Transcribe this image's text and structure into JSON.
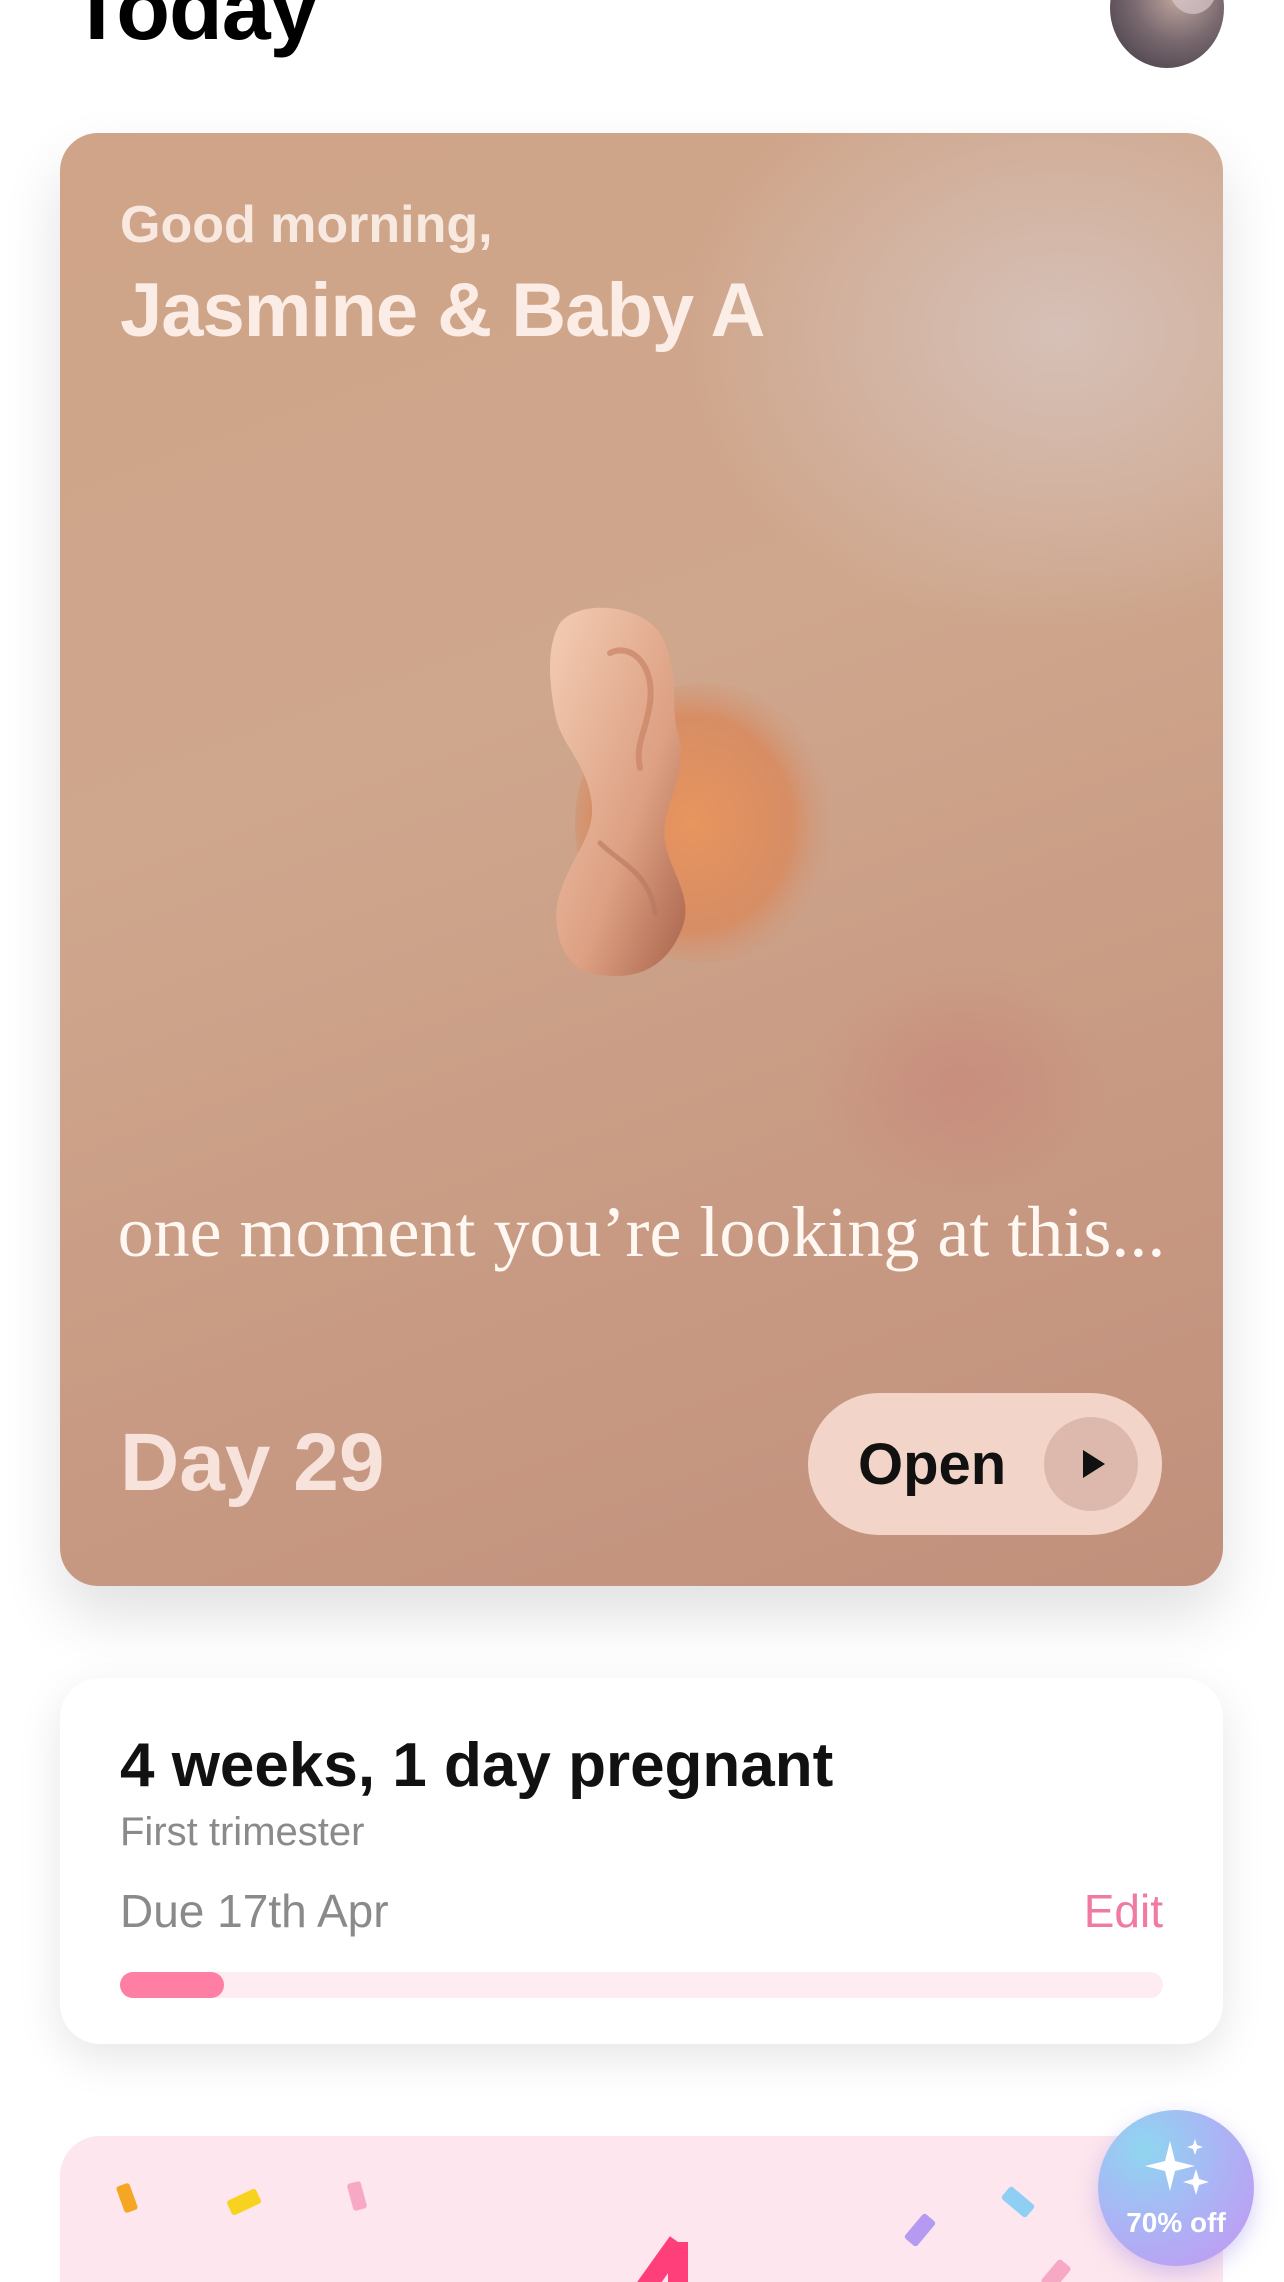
{
  "header": {
    "title": "Today"
  },
  "hero": {
    "greeting": "Good morning,",
    "name": "Jasmine & Baby A",
    "quote": "one moment you’re looking at this...",
    "day_label": "Day 29",
    "open_label": "Open",
    "play_icon": "play-icon"
  },
  "pregnancy": {
    "title": "4 weeks, 1 day pregnant",
    "trimester": "First trimester",
    "due_date": "Due 17th Apr",
    "edit_label": "Edit",
    "progress_fraction": 0.1,
    "progress_color": "#ff7fa4",
    "edit_color": "#f07aa0"
  },
  "promo": {
    "badge_label": "70% off",
    "badge_icon": "sparkles-icon",
    "background_color": "#fde6ed"
  }
}
